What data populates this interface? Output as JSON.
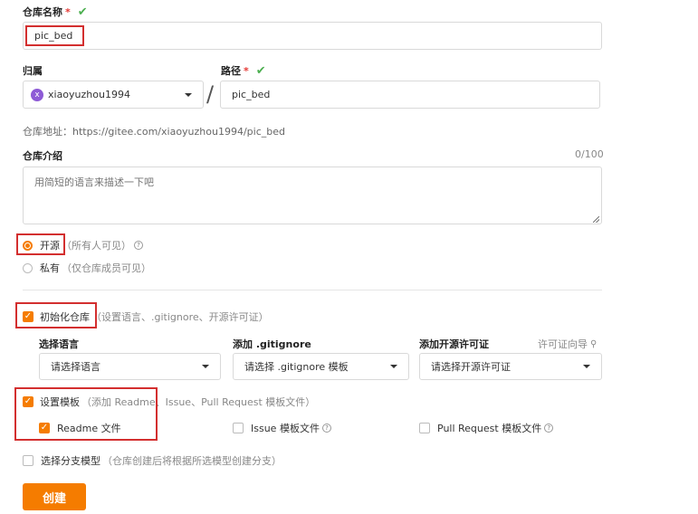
{
  "repo_name": {
    "label": "仓库名称",
    "required": "*",
    "check": "✔",
    "value": "pic_bed"
  },
  "owner": {
    "label": "归属",
    "avatar_letter": "x",
    "value": "xiaoyuzhou1994"
  },
  "slash": "/",
  "path": {
    "label": "路径",
    "required": "*",
    "check": "✔",
    "value": "pic_bed"
  },
  "repo_url": "仓库地址：https://gitee.com/xiaoyuzhou1994/pic_bed",
  "intro": {
    "label": "仓库介绍",
    "counter": "0/100",
    "placeholder": "用简短的语言来描述一下吧"
  },
  "visibility": {
    "public_label": "开源",
    "public_note": "（所有人可见）",
    "private_label": "私有",
    "private_note": "（仅仓库成员可见）"
  },
  "init_repo": {
    "label": "初始化仓库",
    "note": "（设置语言、.gitignore、开源许可证）"
  },
  "language": {
    "label": "选择语言",
    "placeholder": "请选择语言"
  },
  "gitignore": {
    "label": "添加 .gitignore",
    "placeholder": "请选择 .gitignore 模板"
  },
  "license": {
    "label": "添加开源许可证",
    "guide": "许可证向导",
    "placeholder": "请选择开源许可证"
  },
  "templates": {
    "label": "设置模板",
    "note": "（添加 Readme、Issue、Pull Request 模板文件）",
    "readme": "Readme 文件",
    "issue": "Issue 模板文件",
    "pr": "Pull Request 模板文件"
  },
  "branch_model": {
    "label": "选择分支模型",
    "note": "（仓库创建后将根据所选模型创建分支）"
  },
  "create_button": "创建",
  "help_glyph": "?",
  "checkmark_glyph": "✓",
  "guide_glyph": "⚲",
  "colors": {
    "accent": "#f57c00",
    "annotation_red": "#d32f2f",
    "check_green": "#4caf50",
    "avatar": "#8e5bd6"
  }
}
